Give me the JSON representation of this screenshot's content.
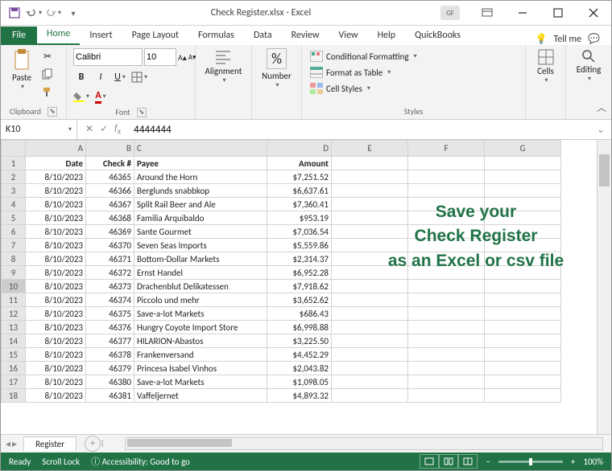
{
  "title": "Check Register.xlsx - Excel",
  "user_initials": "GF",
  "tabs": {
    "file": "File",
    "home": "Home",
    "insert": "Insert",
    "page_layout": "Page Layout",
    "formulas": "Formulas",
    "data": "Data",
    "review": "Review",
    "view": "View",
    "help": "Help",
    "quickbooks": "QuickBooks",
    "tell_me": "Tell me"
  },
  "ribbon": {
    "clipboard": "Clipboard",
    "paste": "Paste",
    "font": "Font",
    "font_name": "Calibri",
    "font_size": "10",
    "alignment": "Alignment",
    "number": "Number",
    "styles": "Styles",
    "cond_fmt": "Conditional Formatting",
    "fmt_table": "Format as Table",
    "cell_styles": "Cell Styles",
    "cells": "Cells",
    "editing": "Editing"
  },
  "namebox": "K10",
  "formula": "4444444",
  "columns": [
    "A",
    "B",
    "C",
    "D",
    "E",
    "F",
    "G"
  ],
  "headers": {
    "A": "Date",
    "B": "Check #",
    "C": "Payee",
    "D": "Amount"
  },
  "rows": [
    {
      "n": 2,
      "A": "8/10/2023",
      "B": "46365",
      "C": "Around the Horn",
      "D": "$7,251.52"
    },
    {
      "n": 3,
      "A": "8/10/2023",
      "B": "46366",
      "C": "Berglunds snabbkop",
      "D": "$6,637.61"
    },
    {
      "n": 4,
      "A": "8/10/2023",
      "B": "46367",
      "C": "Split Rail Beer and Ale",
      "D": "$7,360.41"
    },
    {
      "n": 5,
      "A": "8/10/2023",
      "B": "46368",
      "C": "Familia Arquibaldo",
      "D": "$953.19"
    },
    {
      "n": 6,
      "A": "8/10/2023",
      "B": "46369",
      "C": "Sante Gourmet",
      "D": "$7,036.54"
    },
    {
      "n": 7,
      "A": "8/10/2023",
      "B": "46370",
      "C": "Seven Seas Imports",
      "D": "$5,559.86"
    },
    {
      "n": 8,
      "A": "8/10/2023",
      "B": "46371",
      "C": "Bottom-Dollar Markets",
      "D": "$2,314.37"
    },
    {
      "n": 9,
      "A": "8/10/2023",
      "B": "46372",
      "C": "Ernst Handel",
      "D": "$6,952.28"
    },
    {
      "n": 10,
      "A": "8/10/2023",
      "B": "46373",
      "C": "Drachenblut Delikatessen",
      "D": "$7,918.62"
    },
    {
      "n": 11,
      "A": "8/10/2023",
      "B": "46374",
      "C": "Piccolo und mehr",
      "D": "$3,652.62"
    },
    {
      "n": 12,
      "A": "8/10/2023",
      "B": "46375",
      "C": "Save-a-lot Markets",
      "D": "$686.43"
    },
    {
      "n": 13,
      "A": "8/10/2023",
      "B": "46376",
      "C": "Hungry Coyote Import Store",
      "D": "$6,998.88"
    },
    {
      "n": 14,
      "A": "8/10/2023",
      "B": "46377",
      "C": "HILARION-Abastos",
      "D": "$3,225.50"
    },
    {
      "n": 15,
      "A": "8/10/2023",
      "B": "46378",
      "C": "Frankenversand",
      "D": "$4,452.29"
    },
    {
      "n": 16,
      "A": "8/10/2023",
      "B": "46379",
      "C": "Princesa Isabel Vinhos",
      "D": "$2,043.82"
    },
    {
      "n": 17,
      "A": "8/10/2023",
      "B": "46380",
      "C": "Save-a-lot Markets",
      "D": "$1,098.05"
    },
    {
      "n": 18,
      "A": "8/10/2023",
      "B": "46381",
      "C": "Vaffeljernet",
      "D": "$4,893.32"
    }
  ],
  "overlay": {
    "l1": "Save your",
    "l2": "Check Register",
    "l3": "as an Excel or csv file"
  },
  "sheet_tab": "Register",
  "status": {
    "ready": "Ready",
    "scroll": "Scroll Lock",
    "access": "Accessibility: Good to go",
    "zoom": "100%"
  }
}
